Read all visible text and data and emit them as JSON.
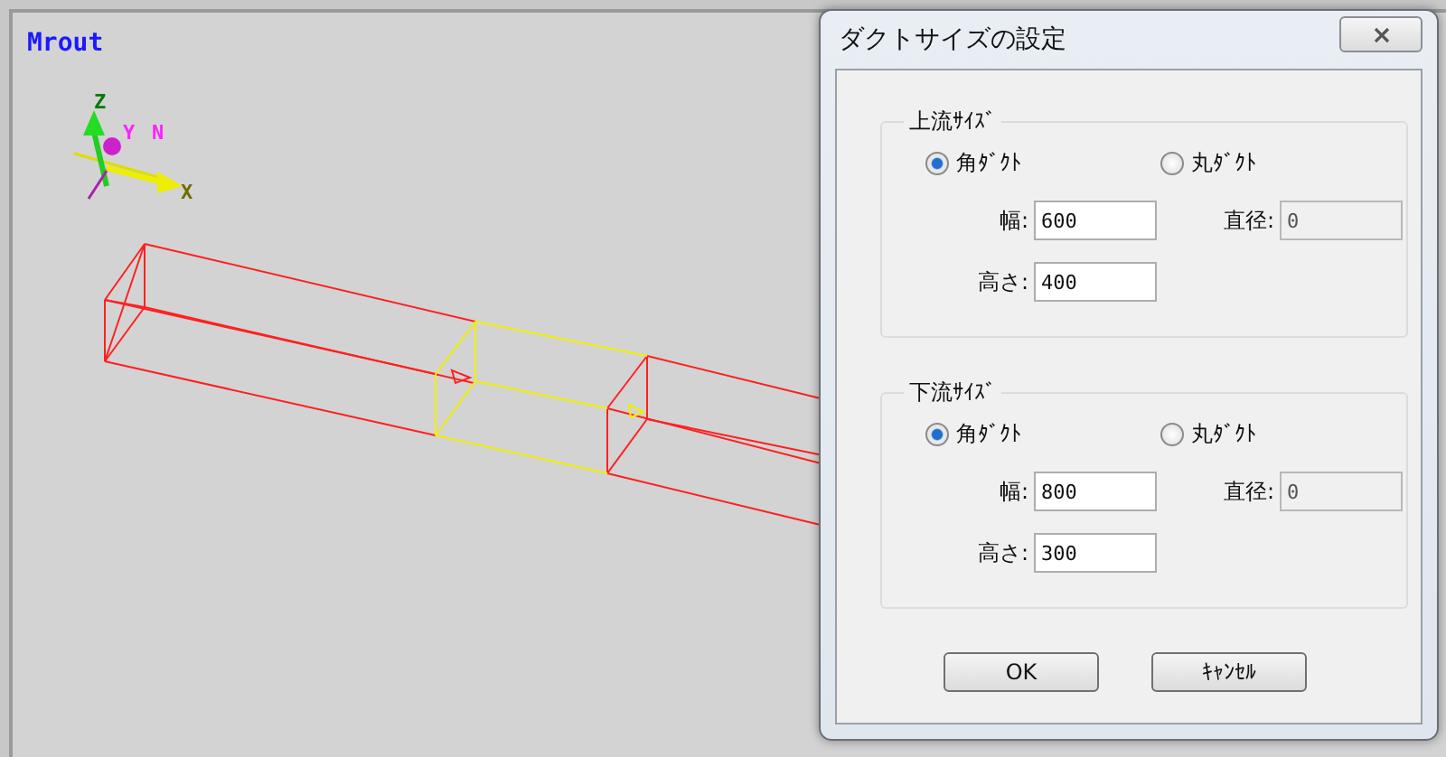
{
  "viewport": {
    "title": "Mrout",
    "axes": [
      {
        "label": "Z",
        "color": "#007a00"
      },
      {
        "label": "Y",
        "color": "#ff22ff"
      },
      {
        "label": "N",
        "color": "#ff22ff"
      },
      {
        "label": "X",
        "color": "#6e6e00"
      }
    ]
  },
  "dialog": {
    "title": "ダクトサイズの設定",
    "sections": [
      {
        "legend": "上流ｻｲｽﾞ",
        "options": [
          {
            "label": "角ﾀﾞｸﾄ",
            "selected": true
          },
          {
            "label": "丸ﾀﾞｸﾄ",
            "selected": false
          }
        ],
        "width": {
          "label": "幅:",
          "value": "600"
        },
        "diameter": {
          "label": "直径:",
          "value": "0",
          "disabled": true
        },
        "height": {
          "label": "高さ:",
          "value": "400"
        }
      },
      {
        "legend": "下流ｻｲｽﾞ",
        "options": [
          {
            "label": "角ﾀﾞｸﾄ",
            "selected": true
          },
          {
            "label": "丸ﾀﾞｸﾄ",
            "selected": false
          }
        ],
        "width": {
          "label": "幅:",
          "value": "800"
        },
        "diameter": {
          "label": "直径:",
          "value": "0",
          "disabled": true
        },
        "height": {
          "label": "高さ:",
          "value": "300"
        }
      }
    ],
    "buttons": [
      "OK",
      "ｷｬﾝｾﾙ"
    ]
  }
}
